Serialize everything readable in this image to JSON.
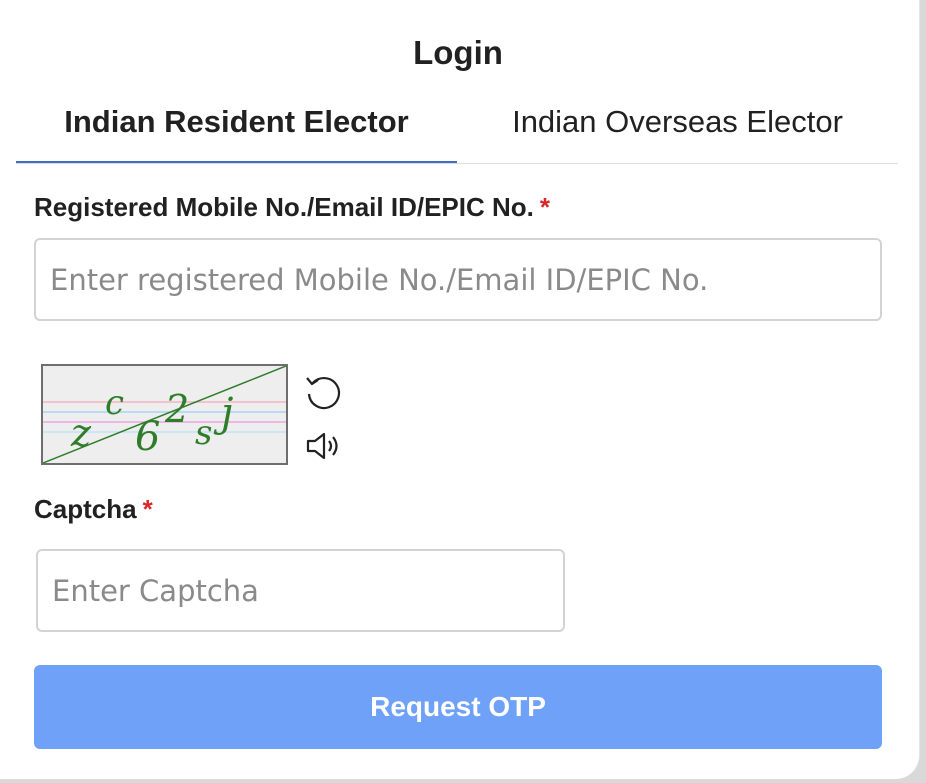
{
  "header": {
    "title": "Login"
  },
  "tabs": [
    {
      "label": "Indian Resident Elector",
      "active": true
    },
    {
      "label": "Indian Overseas Elector",
      "active": false
    }
  ],
  "form": {
    "id_label": "Registered Mobile No./Email ID/EPIC No.",
    "id_placeholder": "Enter registered Mobile No./Email ID/EPIC No.",
    "id_value": "",
    "required_mark": "*",
    "captcha": {
      "chars": [
        "z",
        "c",
        "6",
        "2",
        "s",
        "j"
      ],
      "text_color": "#2f7d2a"
    },
    "captcha_label": "Captcha",
    "captcha_placeholder": "Enter Captcha",
    "captcha_value": ""
  },
  "actions": {
    "submit_label": "Request OTP"
  },
  "icons": {
    "refresh": "refresh-icon",
    "audio": "speaker-icon"
  },
  "colors": {
    "tab_underline": "#3d6dc9",
    "button_bg": "#6ea1f7",
    "required": "#d9262b"
  }
}
